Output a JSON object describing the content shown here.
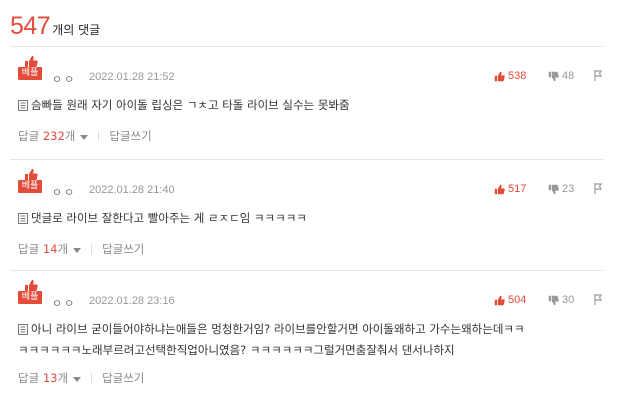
{
  "header": {
    "count": "547",
    "label": "개의 댓글"
  },
  "badge_text": "베플",
  "comments": [
    {
      "author": "ㅇㅇ",
      "date": "2022.01.28 21:52",
      "likes": "538",
      "dislikes": "48",
      "body_lines": [
        "슴빠들 원래 자기 아이돌 립싱은 ㄱㅊ고 타돌 라이브 실수는 못봐줌"
      ],
      "reply_label": "답글",
      "reply_count": "232",
      "reply_unit": "개",
      "write_reply": "답글쓰기"
    },
    {
      "author": "ㅇㅇ",
      "date": "2022.01.28 21:40",
      "likes": "517",
      "dislikes": "23",
      "body_lines": [
        "댓글로 라이브 잘한다고 빨아주는 게 ㄹㅈㄷ임 ㅋㅋㅋㅋㅋ"
      ],
      "reply_label": "답글",
      "reply_count": "14",
      "reply_unit": "개",
      "write_reply": "답글쓰기"
    },
    {
      "author": "ㅇㅇ",
      "date": "2022.01.28 23:16",
      "likes": "504",
      "dislikes": "30",
      "body_lines": [
        "아니 라이브 굳이들어야하냐는애들은 멍청한거임? 라이브를안할거면 아이돌왜하고 가수는왜하는데ㅋㅋ",
        "ㅋㅋㅋㅋㅋㅋ노래부르려고선택한직업아니였음? ㅋㅋㅋㅋㅋㅋ그럴거면춤잘춰서 댄서나하지"
      ],
      "reply_label": "답글",
      "reply_count": "13",
      "reply_unit": "개",
      "write_reply": "답글쓰기"
    }
  ]
}
